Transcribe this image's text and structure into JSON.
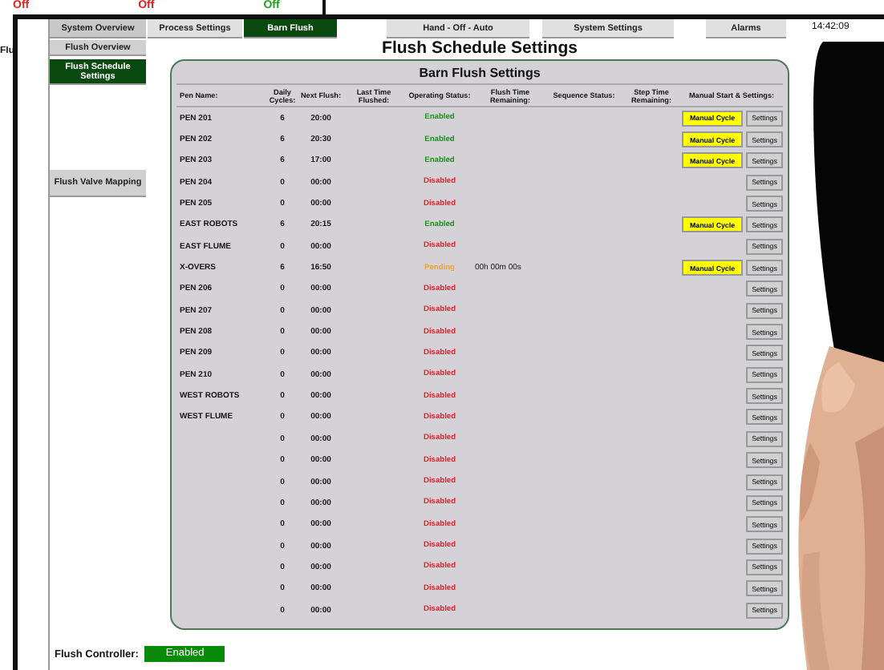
{
  "background_screen": {
    "labels": [
      {
        "text": "Off",
        "color": "#e02020"
      },
      {
        "text": "Off",
        "color": "#e02020"
      },
      {
        "text": "Off",
        "color": "#20a020"
      }
    ],
    "fragment": "Flu"
  },
  "nav_tabs": [
    {
      "label": "System Overview",
      "selected": false
    },
    {
      "label": "Process Settings",
      "selected": false
    },
    {
      "label": "Barn Flush",
      "selected": true
    },
    {
      "label": "Hand - Off - Auto",
      "selected": false
    },
    {
      "label": "System Settings",
      "selected": false
    },
    {
      "label": "Alarms",
      "selected": false
    }
  ],
  "clock": "14:42:09",
  "sidebar": {
    "items": [
      {
        "label": "Flush Overview",
        "selected": false
      },
      {
        "label": "Flush Schedule Settings",
        "selected": true
      },
      {
        "label": "Flush Valve Mapping",
        "selected": false
      }
    ]
  },
  "page_title": "Flush Schedule Settings",
  "panel": {
    "title": "Barn Flush Settings",
    "columns": [
      "Pen Name:",
      "Daily Cycles:",
      "Next Flush:",
      "Last Time Flushed:",
      "Operating Status:",
      "Flush Time Remaining:",
      "Sequence Status:",
      "Step Time Remaining:",
      "Manual Start & Settings:"
    ],
    "rows": [
      {
        "name": "PEN 201",
        "cycles": "6",
        "next": "20:00",
        "status": {
          "text": "Enabled",
          "color": "#1f8f1f"
        },
        "manual": "Manual Cycle",
        "settings": "Settings"
      },
      {
        "name": "PEN 202",
        "cycles": "6",
        "next": "20:30",
        "status": {
          "text": "Enabled",
          "color": "#1f8f1f"
        },
        "manual": "Manual Cycle",
        "settings": "Settings"
      },
      {
        "name": "PEN 203",
        "cycles": "6",
        "next": "17:00",
        "status": {
          "text": "Enabled",
          "color": "#1f8f1f"
        },
        "manual": "Manual Cycle",
        "settings": "Settings"
      },
      {
        "name": "PEN 204",
        "cycles": "0",
        "next": "00:00",
        "status": {
          "text": "Disabled",
          "color": "#e8202a"
        },
        "settings": "Settings"
      },
      {
        "name": "PEN 205",
        "cycles": "0",
        "next": "00:00",
        "status": {
          "text": "Disabled",
          "color": "#e8202a"
        },
        "settings": "Settings"
      },
      {
        "name": "EAST ROBOTS",
        "cycles": "6",
        "next": "20:15",
        "status": {
          "text": "Enabled",
          "color": "#1f8f1f"
        },
        "manual": "Manual Cycle",
        "settings": "Settings"
      },
      {
        "name": "EAST FLUME",
        "cycles": "0",
        "next": "00:00",
        "status": {
          "text": "Disabled",
          "color": "#e8202a"
        },
        "settings": "Settings"
      },
      {
        "name": "X-OVERS",
        "cycles": "6",
        "next": "16:50",
        "status": {
          "text": "Pending",
          "color": "#f0a030"
        },
        "remaining": "00h 00m 00s",
        "manual": "Manual Cycle",
        "settings": "Settings"
      },
      {
        "name": "PEN 206",
        "cycles": "0",
        "next": "00:00",
        "status": {
          "text": "Disabled",
          "color": "#e8202a"
        },
        "settings": "Settings"
      },
      {
        "name": "PEN 207",
        "cycles": "0",
        "next": "00:00",
        "status": {
          "text": "Disabled",
          "color": "#e8202a"
        },
        "settings": "Settings"
      },
      {
        "name": "PEN 208",
        "cycles": "0",
        "next": "00:00",
        "status": {
          "text": "Disabled",
          "color": "#e8202a"
        },
        "settings": "Settings"
      },
      {
        "name": "PEN 209",
        "cycles": "0",
        "next": "00:00",
        "status": {
          "text": "Disabled",
          "color": "#e8202a"
        },
        "settings": "Settings"
      },
      {
        "name": "PEN 210",
        "cycles": "0",
        "next": "00:00",
        "status": {
          "text": "Disabled",
          "color": "#e8202a"
        },
        "settings": "Settings"
      },
      {
        "name": "WEST ROBOTS",
        "cycles": "0",
        "next": "00:00",
        "status": {
          "text": "Disabled",
          "color": "#e8202a"
        },
        "settings": "Settings"
      },
      {
        "name": "WEST FLUME",
        "cycles": "0",
        "next": "00:00",
        "status": {
          "text": "Disabled",
          "color": "#e8202a"
        },
        "settings": "Settings"
      },
      {
        "cycles": "0",
        "next": "00:00",
        "status": {
          "text": "Disabled",
          "color": "#e8202a"
        },
        "settings": "Settings"
      },
      {
        "cycles": "0",
        "next": "00:00",
        "status": {
          "text": "Disabled",
          "color": "#e8202a"
        },
        "settings": "Settings"
      },
      {
        "cycles": "0",
        "next": "00:00",
        "status": {
          "text": "Disabled",
          "color": "#e8202a"
        },
        "settings": "Settings"
      },
      {
        "cycles": "0",
        "next": "00:00",
        "status": {
          "text": "Disabled",
          "color": "#e8202a"
        },
        "settings": "Settings"
      },
      {
        "cycles": "0",
        "next": "00:00",
        "status": {
          "text": "Disabled",
          "color": "#e8202a"
        },
        "settings": "Settings"
      },
      {
        "cycles": "0",
        "next": "00:00",
        "status": {
          "text": "Disabled",
          "color": "#e8202a"
        },
        "settings": "Settings"
      },
      {
        "cycles": "0",
        "next": "00:00",
        "status": {
          "text": "Disabled",
          "color": "#e8202a"
        },
        "settings": "Settings"
      },
      {
        "cycles": "0",
        "next": "00:00",
        "status": {
          "text": "Disabled",
          "color": "#e8202a"
        },
        "settings": "Settings"
      },
      {
        "cycles": "0",
        "next": "00:00",
        "status": {
          "text": "Disabled",
          "color": "#e8202a"
        },
        "settings": "Settings"
      }
    ]
  },
  "footer": {
    "label": "Flush Controller:",
    "value": "Enabled"
  }
}
